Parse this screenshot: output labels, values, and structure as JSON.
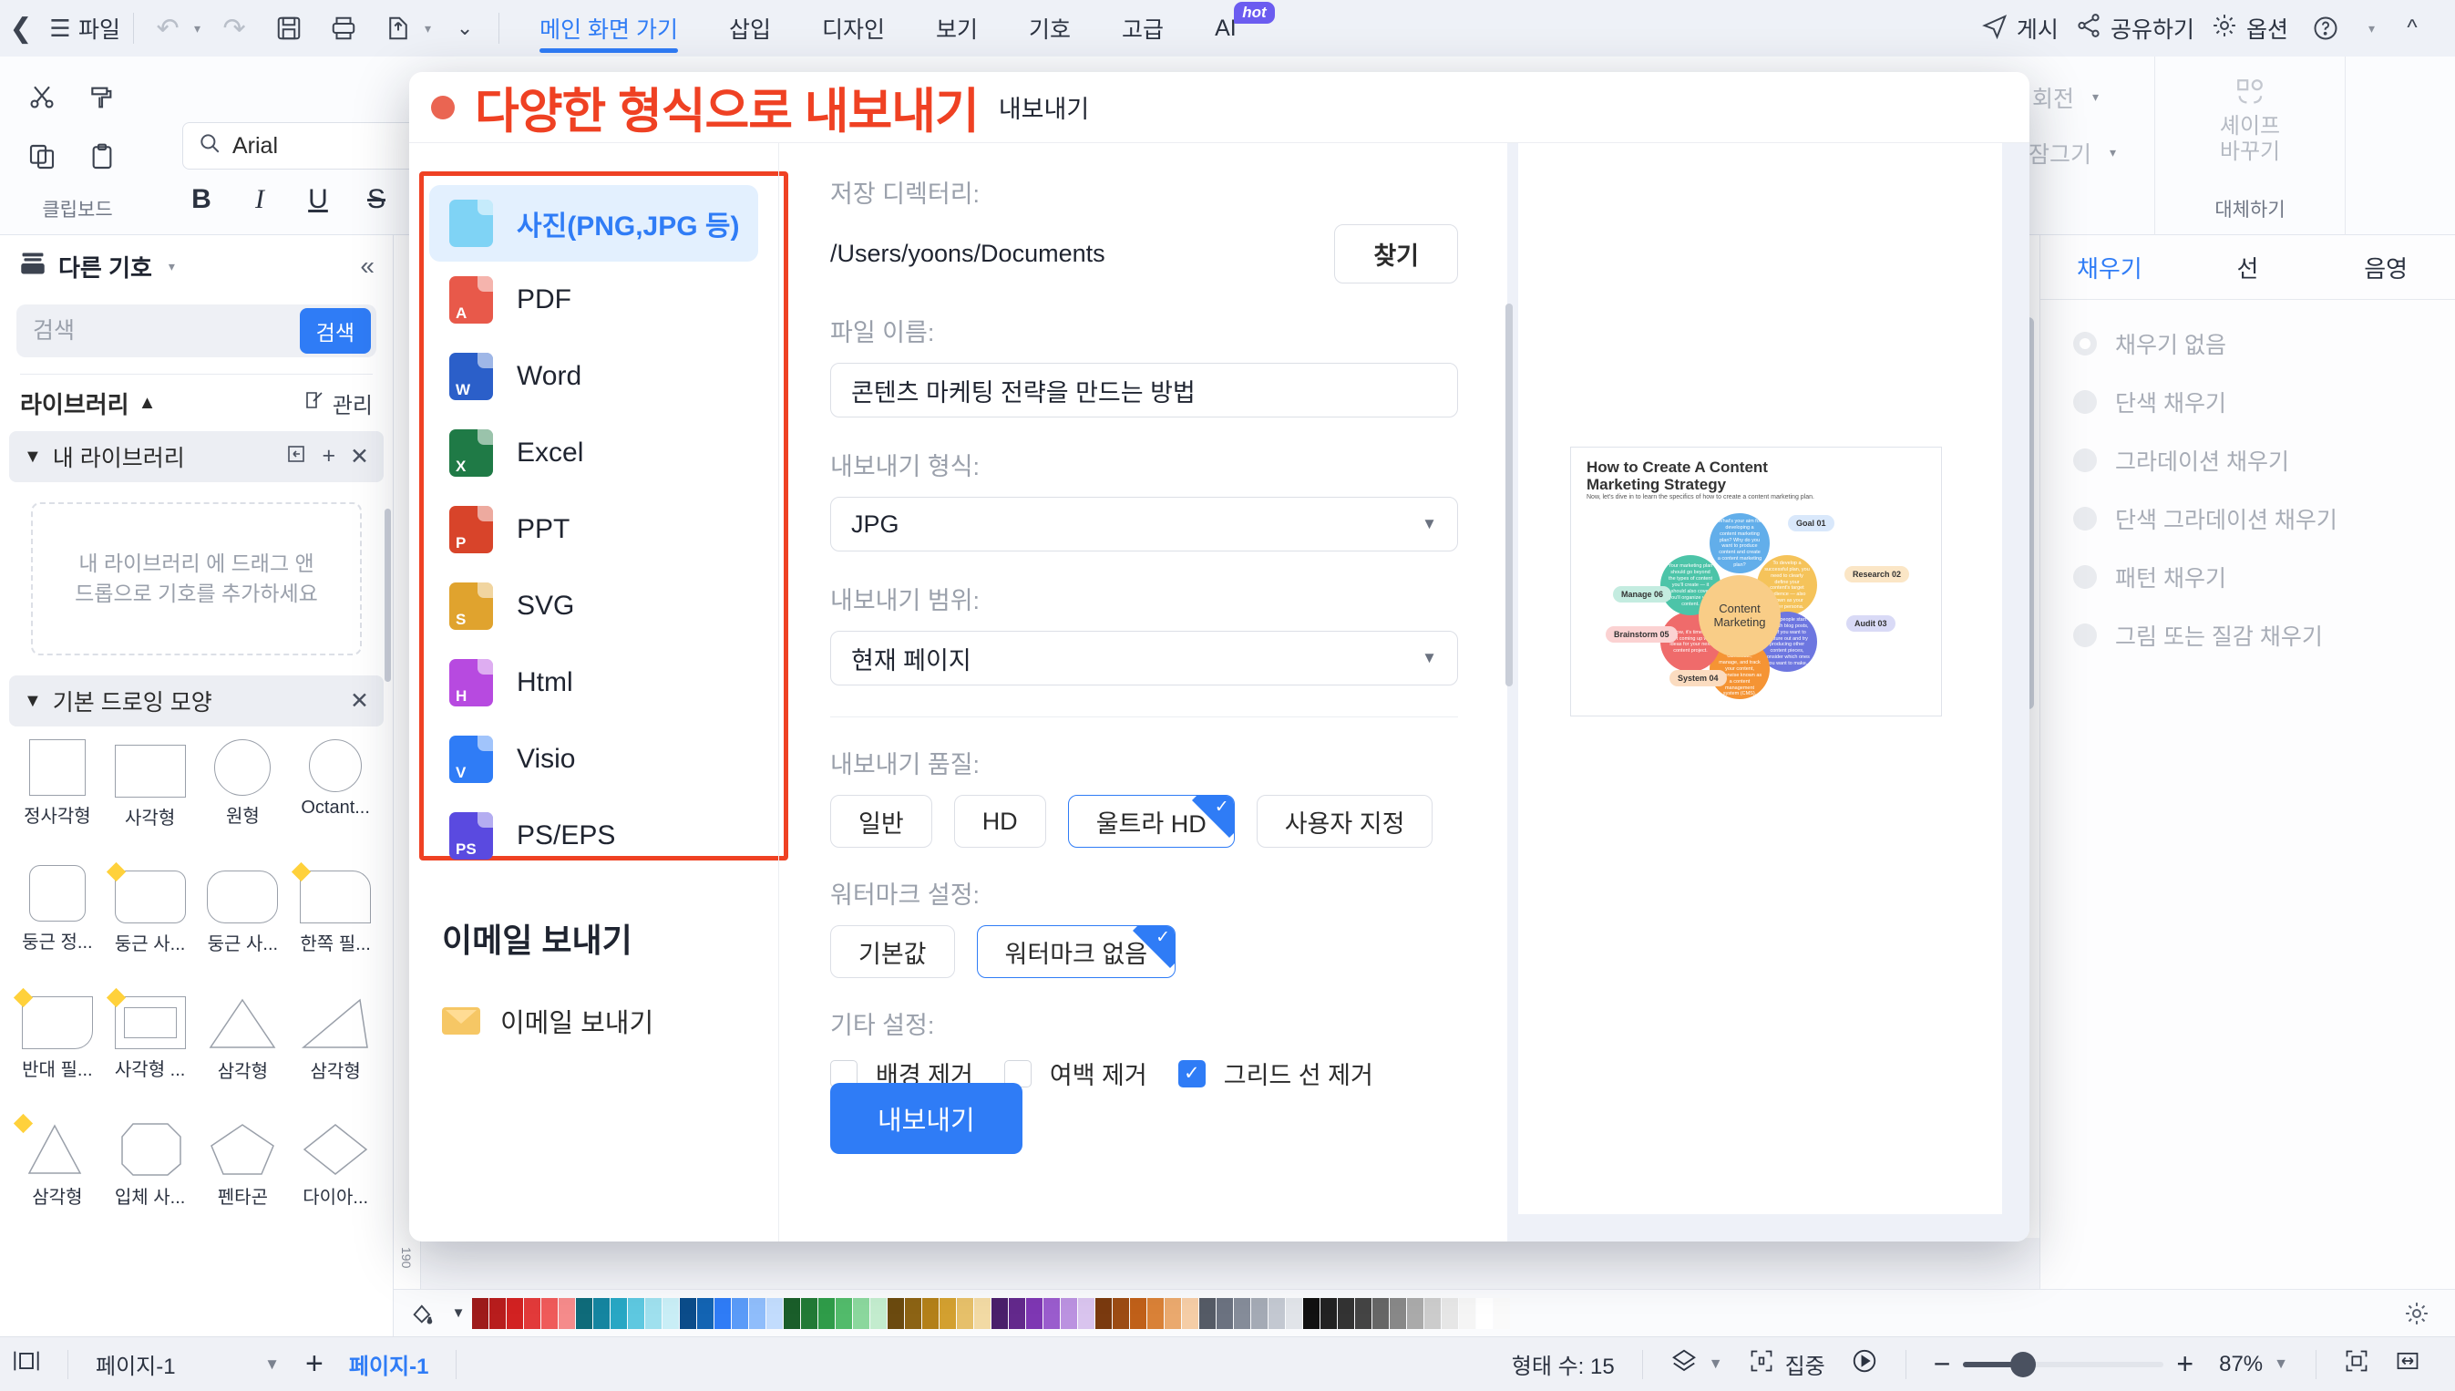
{
  "topbar": {
    "back_icon": "chevron-left-icon",
    "file_menu": "파일",
    "undo_icon": "undo-icon",
    "redo_icon": "redo-icon",
    "save_icon": "save-icon",
    "print_icon": "print-icon",
    "export_icon": "export-icon",
    "more_icon": "chevron-down-icon",
    "tabs": [
      {
        "label": "메인 화면 가기",
        "active": true
      },
      {
        "label": "삽입",
        "active": false
      },
      {
        "label": "디자인",
        "active": false
      },
      {
        "label": "보기",
        "active": false
      },
      {
        "label": "기호",
        "active": false
      },
      {
        "label": "고급",
        "active": false
      },
      {
        "label": "AI",
        "active": false,
        "badge": "hot"
      }
    ],
    "right_items": [
      {
        "label": "게시",
        "icon": "send-icon"
      },
      {
        "label": "공유하기",
        "icon": "share-icon"
      },
      {
        "label": "옵션",
        "icon": "gear-icon"
      }
    ],
    "help_icon": "help-icon",
    "collapse_icon": "chevron-up-icon"
  },
  "ribbon": {
    "clipboard_label": "클립보드",
    "cut_icon": "scissors-icon",
    "format_painter_icon": "format-painter-icon",
    "copy_icon": "copy-icon",
    "paste_icon": "paste-icon",
    "font_name": "Arial",
    "bold": "B",
    "italic": "I",
    "underline": "U",
    "strike": "S",
    "replace_label": "대체하기",
    "rotate_label": "회전",
    "lock_label": "잠그기",
    "shape_change_label_1": "셰이프",
    "shape_change_label_2": "바꾸기"
  },
  "left_panel": {
    "header_title": "다른 기호",
    "header_icon": "library-icon",
    "collapse_icon": "double-chevron-left-icon",
    "search_placeholder": "검색",
    "search_button": "검색",
    "library_title": "라이브러리",
    "manage_label": "관리",
    "my_library_title": "내 라이브러리",
    "dropzone_text": "내 라이브러리 에 드래그 앤 드롭으로 기호를 추가하세요",
    "basic_shapes_title": "기본 드로잉 모양",
    "shapes": [
      {
        "label": "정사각형",
        "type": "square",
        "marker": false
      },
      {
        "label": "사각형",
        "type": "rect",
        "marker": false
      },
      {
        "label": "원형",
        "type": "circle",
        "marker": false
      },
      {
        "label": "Octant...",
        "type": "circle",
        "marker": false
      },
      {
        "label": "둥근 정...",
        "type": "round-square",
        "marker": false
      },
      {
        "label": "둥근 사...",
        "type": "round-rect",
        "marker": true
      },
      {
        "label": "둥근 사...",
        "type": "round-rect2",
        "marker": false
      },
      {
        "label": "한쪽 필...",
        "type": "one-round",
        "marker": true
      },
      {
        "label": "반대 필...",
        "type": "opp-round",
        "marker": true
      },
      {
        "label": "사각형 ...",
        "type": "double-rect",
        "marker": true
      },
      {
        "label": "삼각형",
        "type": "triangle",
        "marker": false
      },
      {
        "label": "삼각형",
        "type": "right-triangle",
        "marker": false
      },
      {
        "label": "삼각형",
        "type": "triangle-thin",
        "marker": true
      },
      {
        "label": "입체 사...",
        "type": "octagon",
        "marker": false
      },
      {
        "label": "펜타곤",
        "type": "pentagon",
        "marker": false
      },
      {
        "label": "다이아...",
        "type": "diamond",
        "marker": false
      }
    ]
  },
  "right_panel": {
    "tabs": [
      {
        "label": "채우기",
        "active": true
      },
      {
        "label": "선",
        "active": false
      },
      {
        "label": "음영",
        "active": false
      }
    ],
    "fill_options": [
      {
        "label": "채우기 없음",
        "selected": true
      },
      {
        "label": "단색 채우기",
        "selected": false
      },
      {
        "label": "그라데이션 채우기",
        "selected": false
      },
      {
        "label": "단색 그라데이션 채우기",
        "selected": false
      },
      {
        "label": "패턴 채우기",
        "selected": false
      },
      {
        "label": "그림 또는 질감 채우기",
        "selected": false
      }
    ]
  },
  "dialog": {
    "dot_color": "#ea6552",
    "title": "다양한 형식으로 내보내기",
    "subtitle": "내보내기",
    "formats": [
      {
        "label": "사진(PNG,JPG 등)",
        "tag": "",
        "color": "#7fd3f5",
        "active": true,
        "icon": "image-file-icon"
      },
      {
        "label": "PDF",
        "tag": "A",
        "color": "#e8594a",
        "active": false,
        "icon": "pdf-file-icon"
      },
      {
        "label": "Word",
        "tag": "W",
        "color": "#2b5fc9",
        "active": false,
        "icon": "word-file-icon"
      },
      {
        "label": "Excel",
        "tag": "X",
        "color": "#1f7a46",
        "active": false,
        "icon": "excel-file-icon"
      },
      {
        "label": "PPT",
        "tag": "P",
        "color": "#d8442a",
        "active": false,
        "icon": "ppt-file-icon"
      },
      {
        "label": "SVG",
        "tag": "S",
        "color": "#e0a32e",
        "active": false,
        "icon": "svg-file-icon"
      },
      {
        "label": "Html",
        "tag": "H",
        "color": "#b74ae0",
        "active": false,
        "icon": "html-file-icon"
      },
      {
        "label": "Visio",
        "tag": "V",
        "color": "#2f7cf6",
        "active": false,
        "icon": "visio-file-icon"
      },
      {
        "label": "PS/EPS",
        "tag": "PS",
        "color": "#5a4ae0",
        "active": false,
        "icon": "ps-file-icon"
      }
    ],
    "email_section_title": "이메일 보내기",
    "email_item_label": "이메일 보내기",
    "email_icon": "envelope-icon",
    "save_dir_label": "저장 디렉터리:",
    "save_dir_value": "/Users/yoons/Documents",
    "browse_button": "찾기",
    "file_name_label": "파일 이름:",
    "file_name_value": "콘텐츠 마케팅 전략을 만드는 방법",
    "export_format_label": "내보내기 형식:",
    "export_format_value": "JPG",
    "export_range_label": "내보내기 범위:",
    "export_range_value": "현재 페이지",
    "quality_label": "내보내기 품질:",
    "quality_options": [
      {
        "label": "일반",
        "selected": false
      },
      {
        "label": "HD",
        "selected": false
      },
      {
        "label": "울트라 HD",
        "selected": true
      },
      {
        "label": "사용자 지정",
        "selected": false
      }
    ],
    "watermark_label": "워터마크 설정:",
    "watermark_options": [
      {
        "label": "기본값",
        "selected": false
      },
      {
        "label": "워터마크 없음",
        "selected": true
      }
    ],
    "other_label": "기타 설정:",
    "checkboxes": [
      {
        "label": "배경 제거",
        "checked": false
      },
      {
        "label": "여백 제거",
        "checked": false
      },
      {
        "label": "그리드 선 제거",
        "checked": true
      }
    ],
    "export_button": "내보내기",
    "preview": {
      "title": "How to Create A Content Marketing Strategy",
      "subtitle": "Now, let's dive in to learn the specifics of how to create a content marketing plan.",
      "center": "Content Marketing",
      "pills": [
        {
          "label": "Goal 01",
          "color": "#d9e8fb"
        },
        {
          "label": "Research 02",
          "color": "#fbe6c6"
        },
        {
          "label": "Audit 03",
          "color": "#d9daf6"
        },
        {
          "label": "System 04",
          "color": "#fbdcc0"
        },
        {
          "label": "Brainstorm 05",
          "color": "#fbd2d2"
        },
        {
          "label": "Manage 06",
          "color": "#c4ece0"
        }
      ],
      "petals": [
        {
          "text": "What's your aim for developing a content marketing plan? Why do you want to produce content and create a content marketing plan?",
          "color": "#62aeea"
        },
        {
          "text": "To develop a successful plan, you need to clearly define your content's target audience — also known as your buyer persona.",
          "color": "#f5c35a"
        },
        {
          "text": "Most people start out with blog posts, but if you want to venture out and try producing other content pieces, consider which ones you want to make.",
          "color": "#6d76e0"
        },
        {
          "text": "Have a system in place where you can create, manage, and track your content, otherwise known as a content management system (CMS).",
          "color": "#f59434"
        },
        {
          "text": "Now, it's time to start coming up with ideas for your next content project.",
          "color": "#ef6b6b"
        },
        {
          "text": "Your marketing plan should go beyond the types of content you'll create — it should also cover you'll organize your content.",
          "color": "#4cc4a8"
        }
      ]
    }
  },
  "status_bar": {
    "page_view_icon": "page-view-icon",
    "page_select_value": "페이지-1",
    "add_page_icon": "plus-icon",
    "page_tab": "페이지-1",
    "shape_count": "형태 수: 15",
    "layers_icon": "layers-icon",
    "focus_label": "집중",
    "play_icon": "play-icon",
    "zoom_out_icon": "minus-icon",
    "zoom_in_icon": "plus-icon",
    "zoom_value": "87%",
    "fit_icon": "fit-page-icon",
    "fit_width_icon": "fit-width-icon",
    "settings_icon": "gear-icon"
  }
}
